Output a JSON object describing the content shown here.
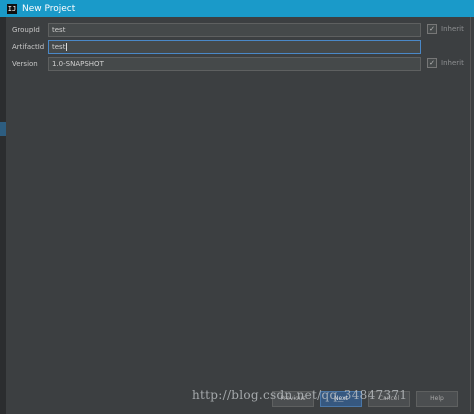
{
  "window": {
    "title": "New Project",
    "icon": "intellij-icon"
  },
  "form": {
    "group_id": {
      "label": "GroupId",
      "value": "test"
    },
    "artifact_id": {
      "label": "ArtifactId",
      "value": "test"
    },
    "version": {
      "label": "Version",
      "value": "1.0-SNAPSHOT"
    },
    "inherit_label": "Inherit"
  },
  "footer": {
    "previous_label": "Previous",
    "next_label": "Next",
    "cancel_label": "Cancel",
    "help_label": "Help"
  },
  "watermark": "http://blog.csdn.net/qq_34847371"
}
